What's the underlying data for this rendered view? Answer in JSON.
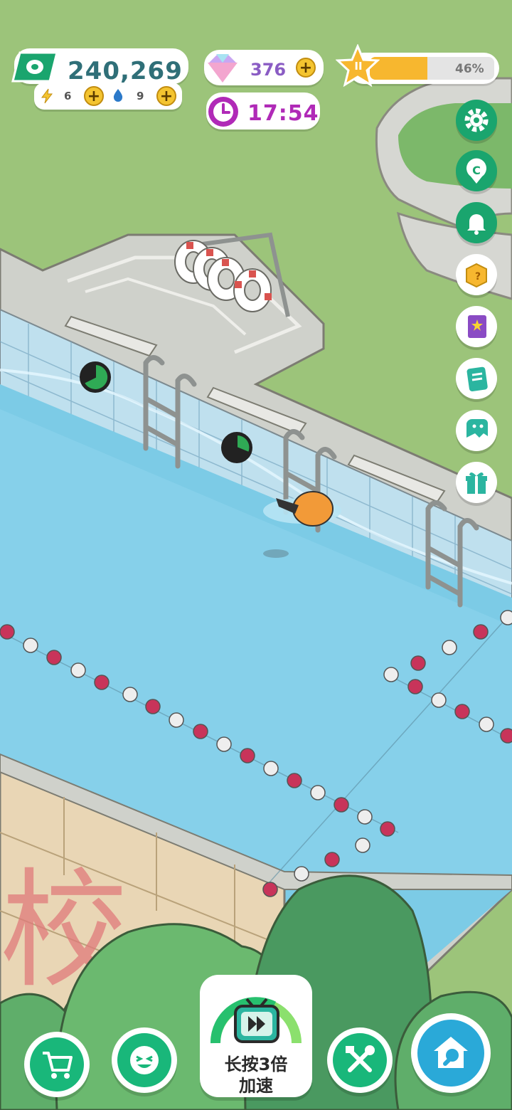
{
  "hud": {
    "money": "240,269",
    "energy_count": "6",
    "water_count": "9",
    "gems": "376",
    "timer": "17:54",
    "progress_label": "46%",
    "progress_value": 0.46,
    "level_badge": "II"
  },
  "side_menu": {
    "icons": [
      "settings-icon",
      "coin-location-icon",
      "bell-icon",
      "mystery-box-icon",
      "star-book-icon",
      "notebook-icon",
      "ghost-chat-icon",
      "gift-icon"
    ]
  },
  "bottom_bar": {
    "speed_label_line1": "长按3倍",
    "speed_label_line2": "加速",
    "icons": [
      "shop-cart-icon",
      "smiley-icon",
      "tv-fast-forward-icon",
      "tools-icon",
      "home-wrench-icon"
    ]
  },
  "scene": {
    "wall_lettering": "校"
  },
  "colors": {
    "grass": "#9cc47a",
    "pool_water": "#7ccbe6",
    "accent_green": "#1aa56e",
    "timer_purple": "#b02ab7",
    "progress_orange": "#f7b72f"
  }
}
